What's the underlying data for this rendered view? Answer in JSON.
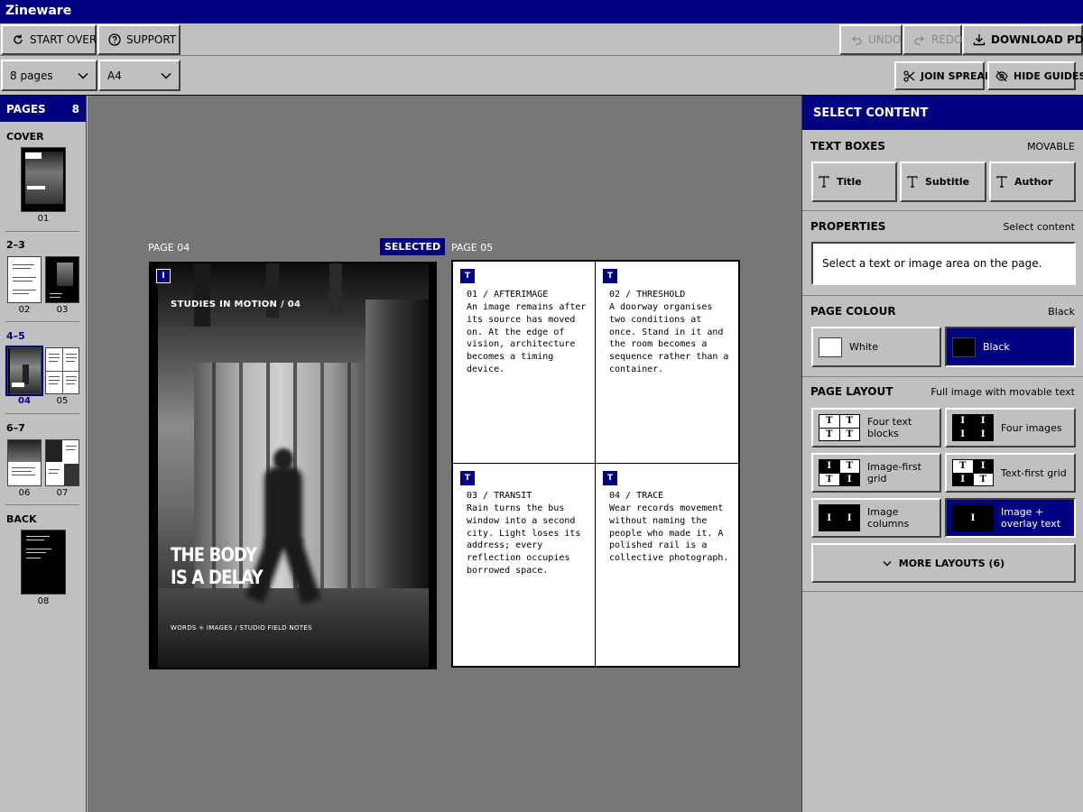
{
  "app": {
    "title": "Zineware"
  },
  "toolbar": {
    "start_over": "START OVER",
    "support": "SUPPORT",
    "undo": "UNDO",
    "redo": "REDO",
    "download_pdf": "DOWNLOAD PDF"
  },
  "options": {
    "pages_select": "8 pages",
    "size_select": "A4",
    "join_spread": "JOIN SPREAD",
    "hide_guides": "HIDE GUIDES"
  },
  "pages_panel": {
    "title": "PAGES",
    "count": "8",
    "groups": [
      {
        "label": "COVER",
        "pages": [
          "01"
        ]
      },
      {
        "label": "2–3",
        "pages": [
          "02",
          "03"
        ]
      },
      {
        "label": "4–5",
        "pages": [
          "04",
          "05"
        ],
        "active": true
      },
      {
        "label": "6–7",
        "pages": [
          "06",
          "07"
        ]
      },
      {
        "label": "BACK",
        "pages": [
          "08"
        ]
      }
    ]
  },
  "canvas": {
    "left_page_label": "PAGE 04",
    "right_page_label": "PAGE 05",
    "selected_badge": "SELECTED",
    "page04": {
      "badge": "I",
      "kicker": "STUDIES IN MOTION / 04",
      "title_line1": "THE BODY",
      "title_line2": "IS A DELAY",
      "footer": "WORDS + IMAGES / STUDIO FIELD NOTES"
    },
    "page05": {
      "cells": [
        {
          "badge": "T",
          "title": "01 / AFTERIMAGE",
          "body": "An image remains after its source has moved on. At the edge of vision, architecture becomes a timing device."
        },
        {
          "badge": "T",
          "title": "02 / THRESHOLD",
          "body": "A doorway organises two conditions at once. Stand in it and the room becomes a sequence rather than a container."
        },
        {
          "badge": "T",
          "title": "03 / TRANSIT",
          "body": "Rain turns the bus window into a second city. Light loses its address; every reflection occupies borrowed space."
        },
        {
          "badge": "T",
          "title": "04 / TRACE",
          "body": "Wear records movement without naming the people who made it. A polished rail is a collective photograph."
        }
      ]
    }
  },
  "right_panel": {
    "title": "SELECT CONTENT",
    "text_boxes": {
      "title": "TEXT BOXES",
      "note": "MOVABLE",
      "buttons": [
        "Title",
        "Subtitle",
        "Author"
      ]
    },
    "properties": {
      "title": "PROPERTIES",
      "note": "Select content",
      "message": "Select a text or image area on the page."
    },
    "page_colour": {
      "title": "PAGE COLOUR",
      "note": "Black",
      "options": [
        "White",
        "Black"
      ],
      "selected": "Black"
    },
    "page_layout": {
      "title": "PAGE LAYOUT",
      "note": "Full image with movable text",
      "layouts": [
        "Four text blocks",
        "Four images",
        "Image-first grid",
        "Text-first grid",
        "Image columns",
        "Image + overlay text"
      ],
      "selected": "Image + overlay text",
      "more": "MORE LAYOUTS (6)"
    }
  },
  "colors": {
    "accent": "#000080",
    "panel": "#c0c0c0",
    "canvas": "#777777"
  },
  "icons": [
    "refresh-icon",
    "help-icon",
    "undo-icon",
    "redo-icon",
    "download-icon",
    "chevron-down-icon",
    "scissors-icon",
    "eye-off-icon",
    "text-icon"
  ]
}
